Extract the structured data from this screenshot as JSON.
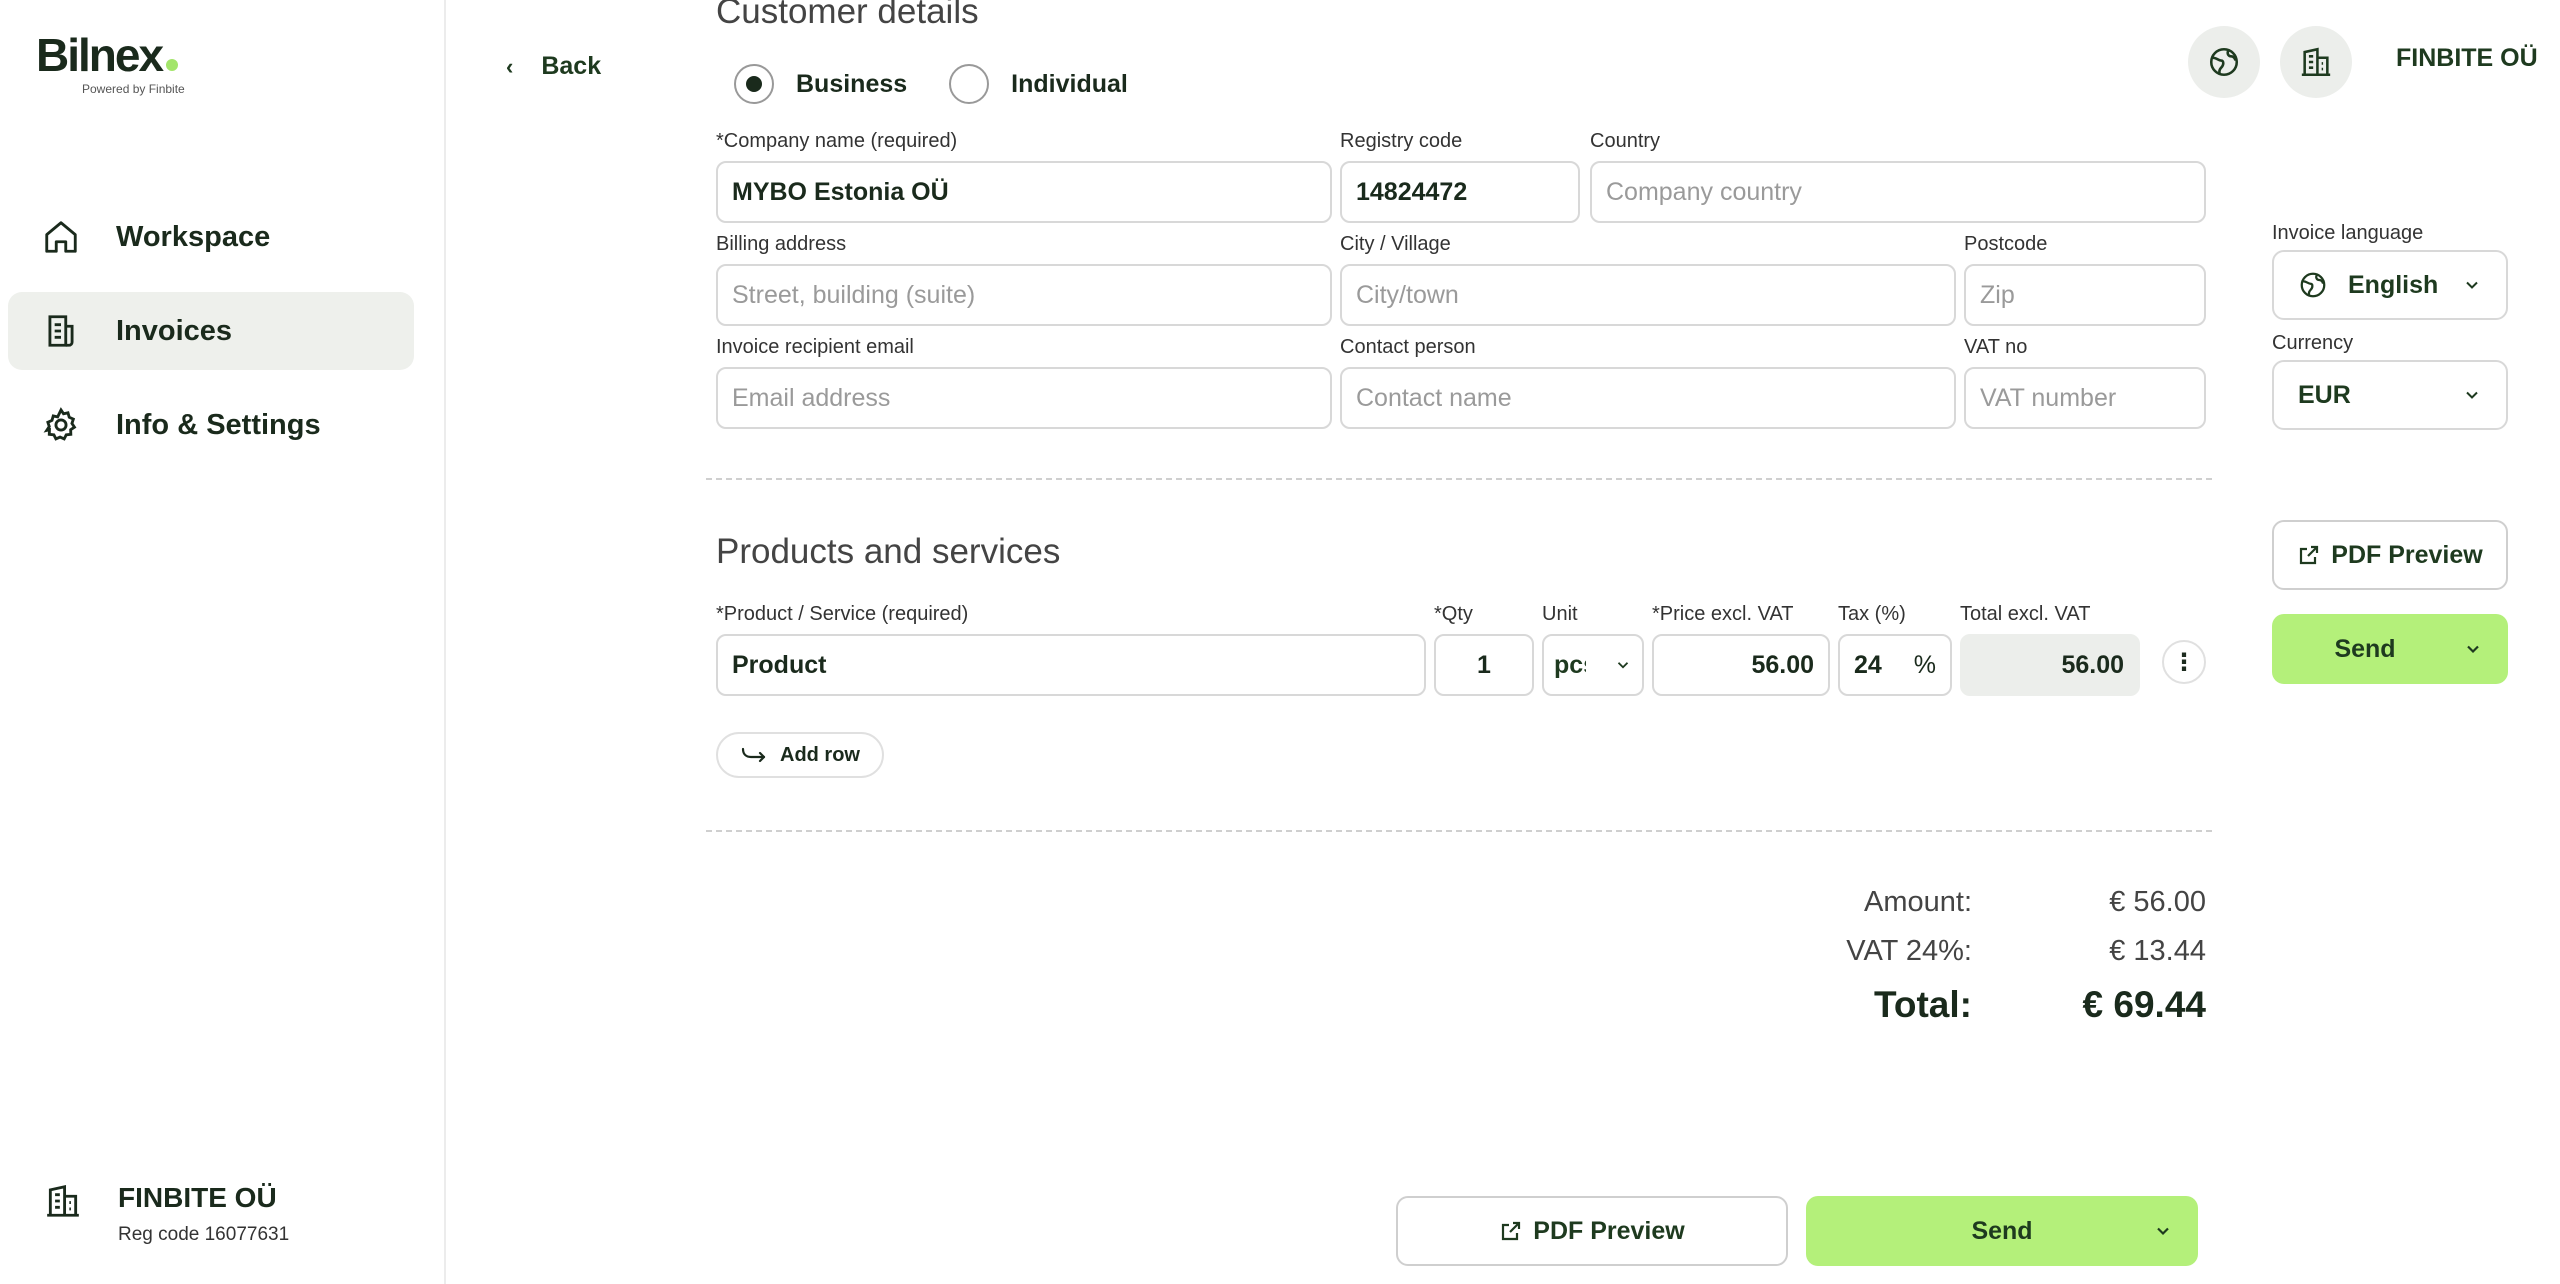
{
  "brand": {
    "name": "Bilnex",
    "tagline": "Powered by Finbite"
  },
  "sidebar": {
    "items": [
      {
        "label": "Workspace",
        "icon": "home-icon"
      },
      {
        "label": "Invoices",
        "icon": "invoice-icon",
        "active": true
      },
      {
        "label": "Info & Settings",
        "icon": "gear-icon"
      }
    ],
    "org": {
      "name": "FINBITE OÜ",
      "reg": "Reg code 16077631"
    }
  },
  "topbar": {
    "back": "Back",
    "company": "FINBITE OÜ"
  },
  "customer": {
    "title": "Customer details",
    "type_business": "Business",
    "type_individual": "Individual",
    "company_label": "*Company name (required)",
    "company_value": "MYBO Estonia OÜ",
    "registry_label": "Registry code",
    "registry_value": "14824472",
    "country_label": "Country",
    "country_placeholder": "Company country",
    "billing_label": "Billing address",
    "billing_placeholder": "Street, building (suite)",
    "city_label": "City / Village",
    "city_placeholder": "City/town",
    "postcode_label": "Postcode",
    "postcode_placeholder": "Zip",
    "email_label": "Invoice recipient email",
    "email_placeholder": "Email address",
    "contact_label": "Contact person",
    "contact_placeholder": "Contact name",
    "vat_label": "VAT no",
    "vat_placeholder": "VAT number"
  },
  "products": {
    "title": "Products and services",
    "headers": {
      "product": "*Product / Service (required)",
      "qty": "*Qty",
      "unit": "Unit",
      "price": "*Price excl. VAT",
      "tax": "Tax (%)",
      "total": "Total excl. VAT"
    },
    "row": {
      "product": "Product",
      "qty": "1",
      "unit": "pcs",
      "price": "56.00",
      "tax": "24",
      "tax_suffix": "%",
      "total": "56.00"
    },
    "add_row": "Add row"
  },
  "totals": {
    "amount_label": "Amount:",
    "amount": "€ 56.00",
    "vat_label": "VAT 24%:",
    "vat": "€ 13.44",
    "total_label": "Total:",
    "total": "€ 69.44"
  },
  "settings": {
    "language_label": "Invoice language",
    "language": "English",
    "currency_label": "Currency",
    "currency": "EUR"
  },
  "actions": {
    "pdf_preview": "PDF Preview",
    "send": "Send"
  },
  "colors": {
    "accent_green": "#b4f07a",
    "text_dark_green": "#1e3a1f",
    "active_nav_bg": "#eef0ec"
  }
}
